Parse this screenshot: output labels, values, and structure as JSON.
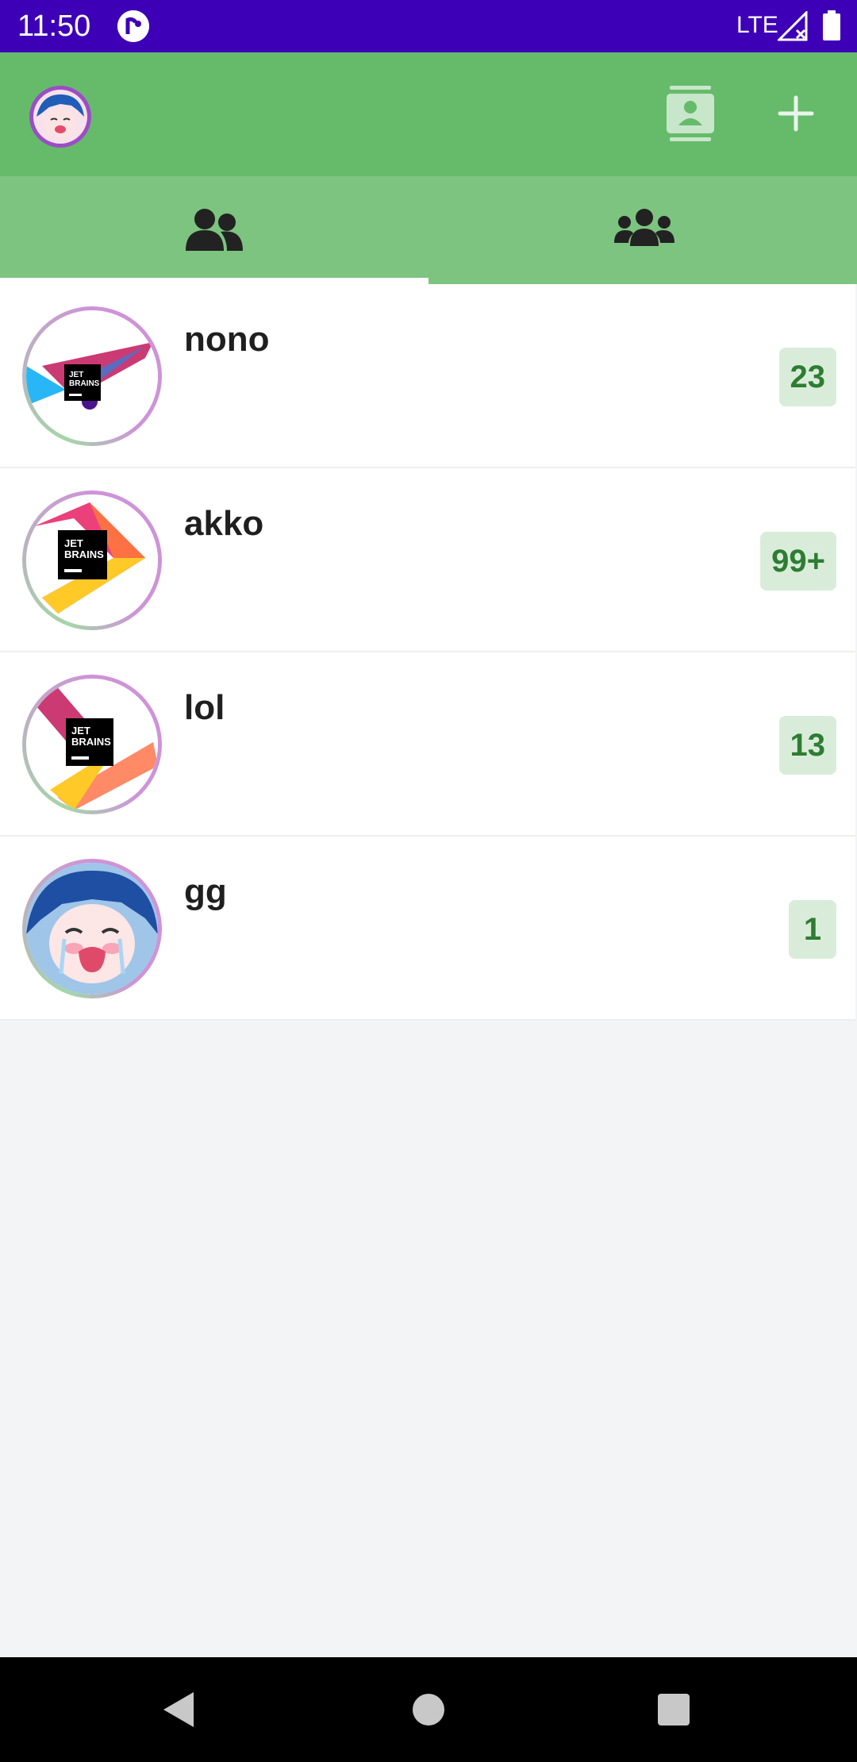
{
  "status_bar": {
    "time": "11:50",
    "network": "LTE"
  },
  "colors": {
    "status_bar": "#3d00b7",
    "app_bar": "#66bb6a",
    "tab_bar": "#7cc47f",
    "badge_bg": "#d9ecda",
    "badge_text": "#2e7d32",
    "list_background": "#f3f4f6"
  },
  "app_bar": {
    "avatar_icon": "user-avatar-icon",
    "contacts_icon": "contact-card-icon",
    "add_icon": "plus-icon"
  },
  "tabs": [
    {
      "icon": "two-users-icon",
      "selected": true
    },
    {
      "icon": "group-icon",
      "selected": false
    }
  ],
  "conversations": [
    {
      "name": "nono",
      "unread": "23",
      "avatar": "jetbrains-logo-blue-pink"
    },
    {
      "name": "akko",
      "unread": "99+",
      "avatar": "jetbrains-logo-orange-yellow"
    },
    {
      "name": "lol",
      "unread": "13",
      "avatar": "jetbrains-logo-red-yellow"
    },
    {
      "name": "gg",
      "unread": "1",
      "avatar": "anime-character-avatar"
    }
  ],
  "nav_bar": {
    "back_icon": "back-triangle-icon",
    "home_icon": "home-circle-icon",
    "recent_icon": "recents-square-icon"
  }
}
